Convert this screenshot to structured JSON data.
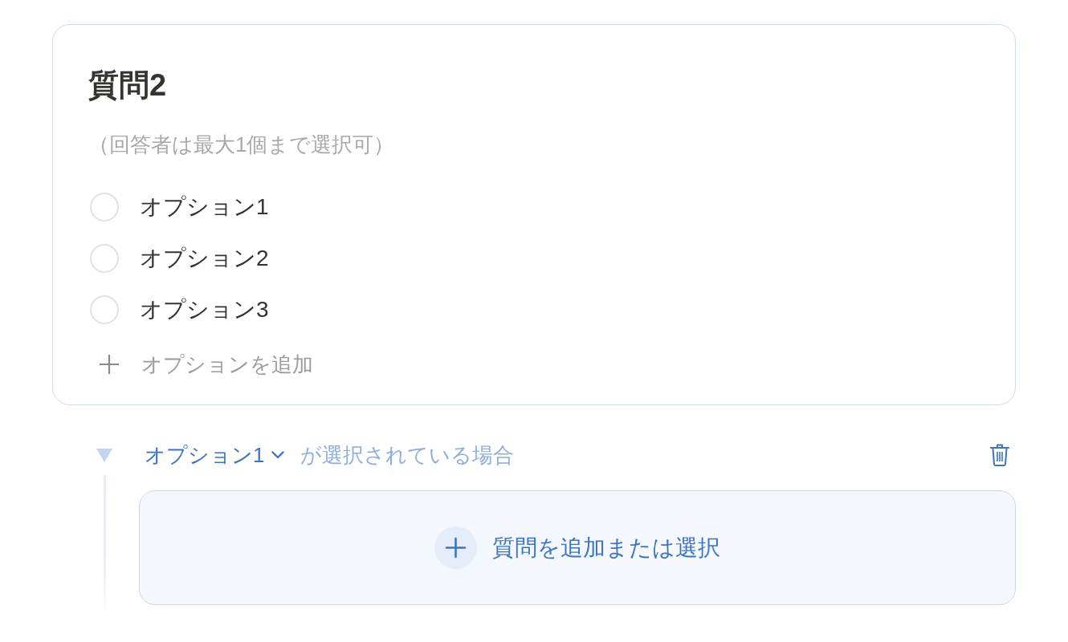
{
  "question": {
    "title": "質問2",
    "hint": "（回答者は最大1個まで選択可）",
    "options": [
      {
        "label": "オプション1",
        "selected": false
      },
      {
        "label": "オプション2",
        "selected": false
      },
      {
        "label": "オプション3",
        "selected": false
      }
    ],
    "add_option": "オプションを追加"
  },
  "branch": {
    "expanded": true,
    "option": "オプション1",
    "condition": "が選択されている場合",
    "add_question": "質問を追加または選択"
  }
}
